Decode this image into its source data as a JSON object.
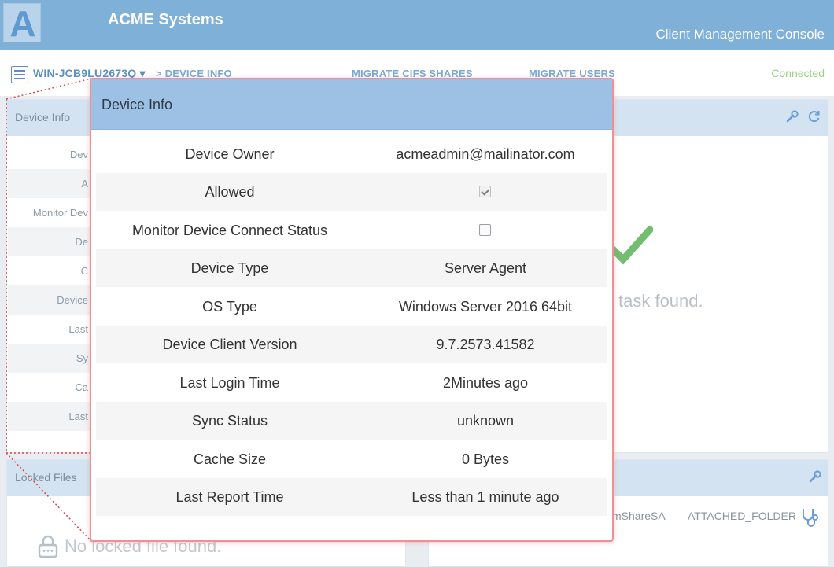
{
  "header": {
    "logo_letter": "A",
    "company": "ACME Systems",
    "console_title": "Client Management Console"
  },
  "nav": {
    "server_name": "WIN-JCB9LU2673Q ▾",
    "device_info": "> DEVICE INFO",
    "migrate_cifs": "MIGRATE CIFS SHARES",
    "migrate_users": "MIGRATE USERS",
    "status": "Connected"
  },
  "background": {
    "device_info_panel_title": "Device Info",
    "rows": [
      "Dev",
      "A",
      "Monitor Dev",
      "De",
      "C",
      "Device",
      "Last",
      "Sy",
      "Ca",
      "Last"
    ],
    "no_task_text": "task found.",
    "locked_files_title": "Locked Files",
    "no_locked_text": "No locked file found.",
    "share_cell": "mShareSA",
    "attached_folder": "ATTACHED_FOLDER",
    "colors": {
      "header": "#7fb0d8",
      "panel_head": "#d4e3f1",
      "check": "#72bd6f"
    }
  },
  "modal": {
    "title": "Device Info",
    "rows": [
      {
        "label": "Device Owner",
        "value": "acmeadmin@mailinator.com"
      },
      {
        "label": "Allowed",
        "checkbox": true
      },
      {
        "label": "Monitor Device Connect Status",
        "checkbox": false
      },
      {
        "label": "Device Type",
        "value": "Server Agent"
      },
      {
        "label": "OS Type",
        "value": "Windows Server 2016 64bit"
      },
      {
        "label": "Device Client Version",
        "value": "9.7.2573.41582"
      },
      {
        "label": "Last Login Time",
        "value": "2Minutes ago"
      },
      {
        "label": "Sync Status",
        "value": "unknown"
      },
      {
        "label": "Cache Size",
        "value": "0 Bytes"
      },
      {
        "label": "Last Report Time",
        "value": "Less than 1 minute ago"
      }
    ],
    "border_color": "#f08f96"
  },
  "icons": [
    "list-icon",
    "wrench-icon",
    "refresh-icon",
    "check-icon",
    "lock-icon",
    "stethoscope-icon",
    "checkbox-icon"
  ]
}
